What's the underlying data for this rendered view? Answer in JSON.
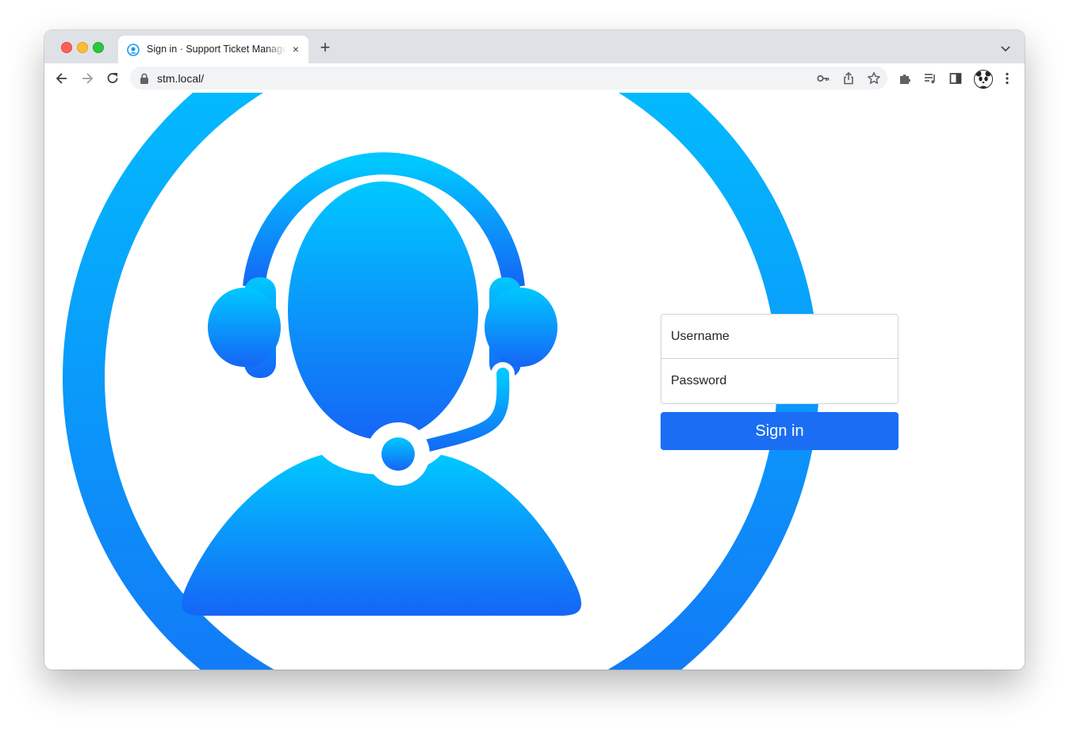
{
  "browser": {
    "tab": {
      "title": "Sign in · Support Ticket Management",
      "close_glyph": "×",
      "favicon": "support-agent-icon"
    },
    "new_tab_glyph": "+",
    "address_bar": {
      "url": "stm.local/"
    },
    "icons": [
      "back-icon",
      "forward-icon",
      "reload-icon",
      "lock-icon",
      "key-icon",
      "share-icon",
      "star-icon",
      "extensions-icon",
      "media-icon",
      "side-panel-icon",
      "profile-avatar",
      "more-menu-icon"
    ]
  },
  "login": {
    "username_placeholder": "Username",
    "password_placeholder": "Password",
    "submit_label": "Sign in"
  },
  "colors": {
    "primary": "#1b6ef3",
    "hero_gradient_top": "#00c8ff",
    "hero_gradient_bottom": "#1565f6"
  }
}
